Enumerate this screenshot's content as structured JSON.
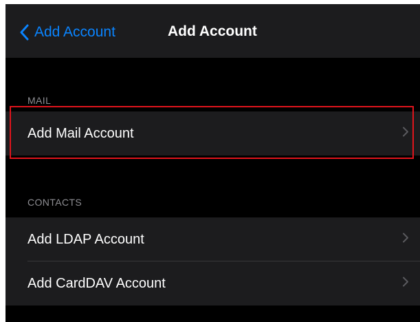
{
  "navbar": {
    "back_label": "Add Account",
    "title": "Add Account"
  },
  "sections": {
    "mail": {
      "header": "MAIL",
      "items": [
        {
          "label": "Add Mail Account"
        }
      ]
    },
    "contacts": {
      "header": "CONTACTS",
      "items": [
        {
          "label": "Add LDAP Account"
        },
        {
          "label": "Add CardDAV Account"
        }
      ]
    }
  },
  "colors": {
    "accent": "#0a84ff",
    "background": "#000000",
    "cell_background": "#1c1c1e",
    "secondary_text": "#8e8e93",
    "highlight_border": "#e0141c"
  },
  "icons": {
    "back": "chevron-left-icon",
    "disclosure": "chevron-right-icon"
  }
}
